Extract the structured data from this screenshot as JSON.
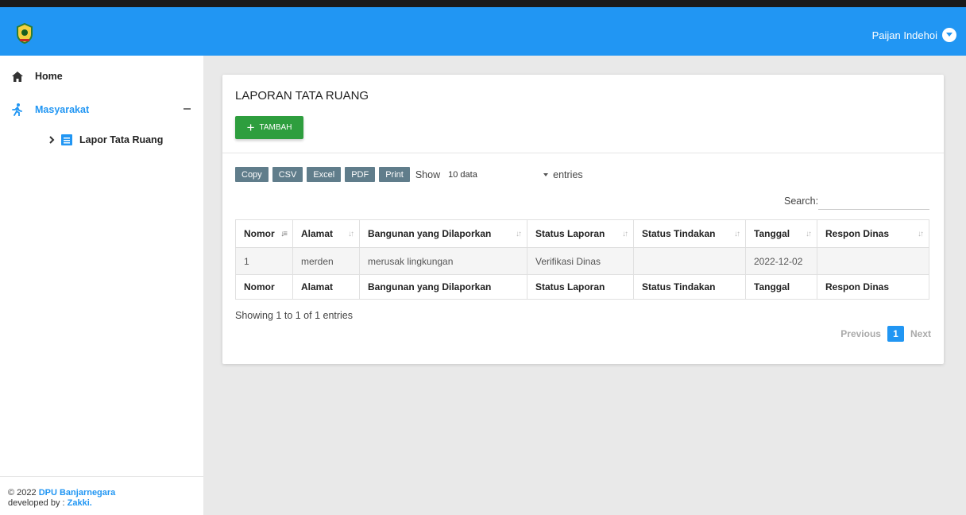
{
  "topbar": {
    "user_name": "Paijan Indehoi"
  },
  "sidebar": {
    "home_label": "Home",
    "masyarakat_label": "Masyarakat",
    "sub_item_label": "Lapor Tata Ruang",
    "footer_year": "© 2022",
    "footer_org": "DPU Banjarnegara",
    "footer_dev_prefix": "developed by :",
    "footer_dev": "Zakki."
  },
  "card": {
    "title": "LAPORAN TATA RUANG",
    "add_button": "TAMBAH"
  },
  "table_controls": {
    "export_buttons": [
      "Copy",
      "CSV",
      "Excel",
      "PDF",
      "Print"
    ],
    "show_label": "Show",
    "page_size_selected": "10 data",
    "entries_label": "entries",
    "search_label": "Search:",
    "search_value": ""
  },
  "table": {
    "headers": [
      "Nomor",
      "Alamat",
      "Bangunan yang Dilaporkan",
      "Status Laporan",
      "Status Tindakan",
      "Tanggal",
      "Respon Dinas"
    ],
    "rows": [
      [
        "1",
        "merden",
        "merusak lingkungan",
        "Verifikasi Dinas",
        "",
        "2022-12-02",
        ""
      ]
    ]
  },
  "footer": {
    "info": "Showing 1 to 1 of 1 entries",
    "prev": "Previous",
    "page": "1",
    "next": "Next"
  },
  "colors": {
    "primary": "#2196f3",
    "add_button": "#2e9e3e",
    "export_button": "#607d8b"
  }
}
